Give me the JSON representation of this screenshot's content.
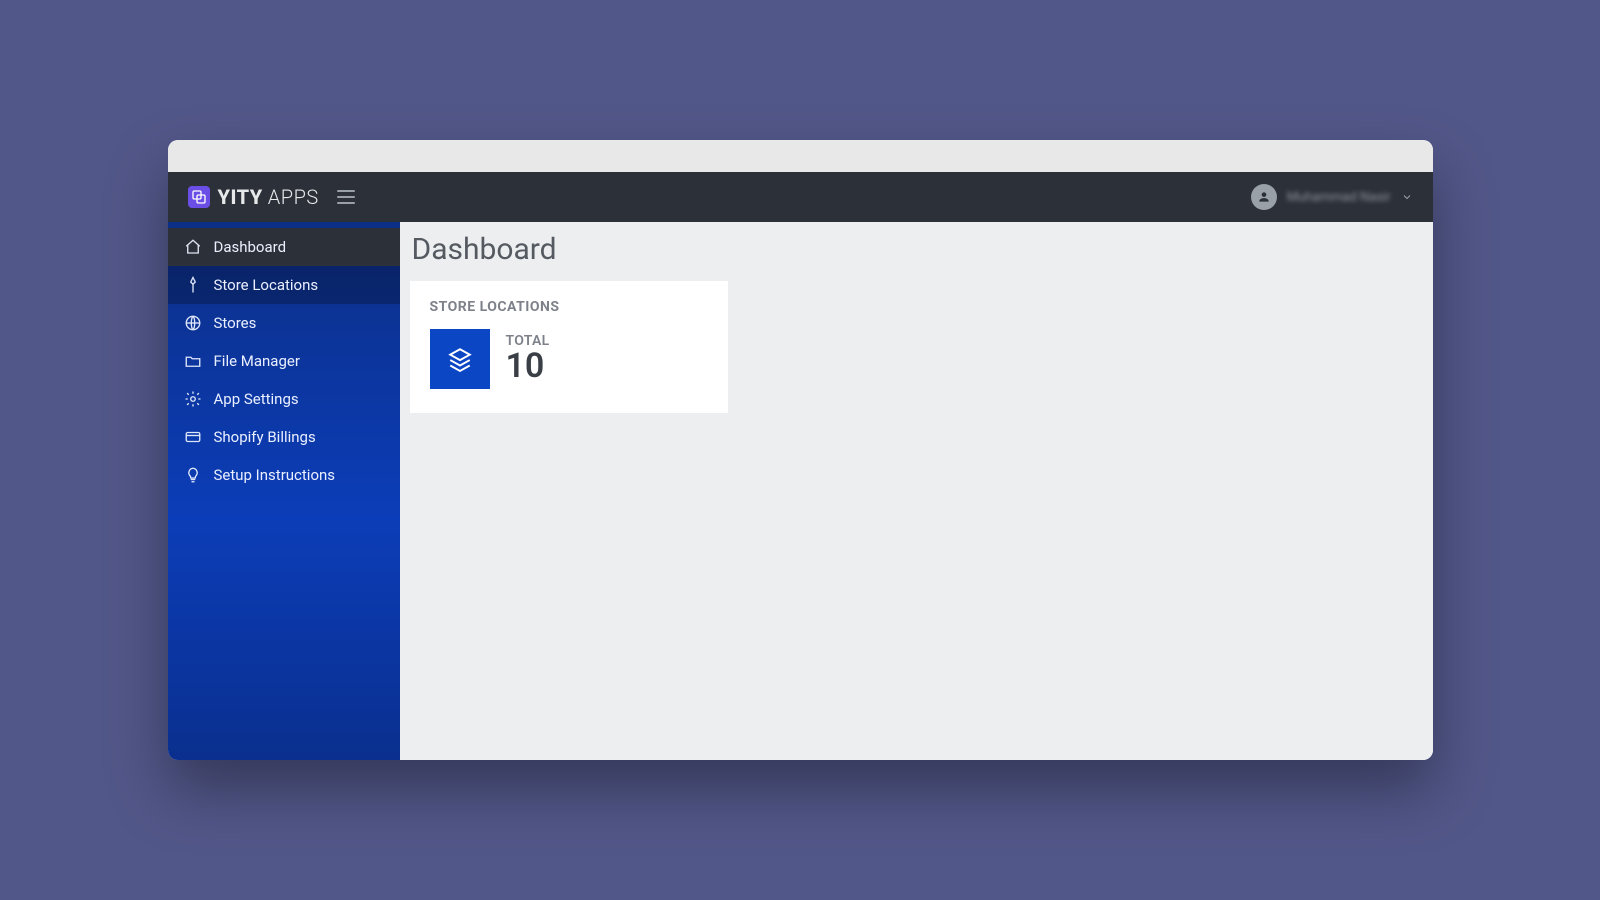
{
  "brand": {
    "name_bold": "YITY",
    "name_light": "APPS"
  },
  "user": {
    "display_name": "Muhammad Nasir"
  },
  "sidebar": {
    "items": [
      {
        "label": "Dashboard"
      },
      {
        "label": "Store Locations"
      },
      {
        "label": "Stores"
      },
      {
        "label": "File Manager"
      },
      {
        "label": "App Settings"
      },
      {
        "label": "Shopify Billings"
      },
      {
        "label": "Setup Instructions"
      }
    ]
  },
  "page": {
    "title": "Dashboard"
  },
  "stat_card": {
    "header": "STORE LOCATIONS",
    "label": "TOTAL",
    "value": "10"
  }
}
